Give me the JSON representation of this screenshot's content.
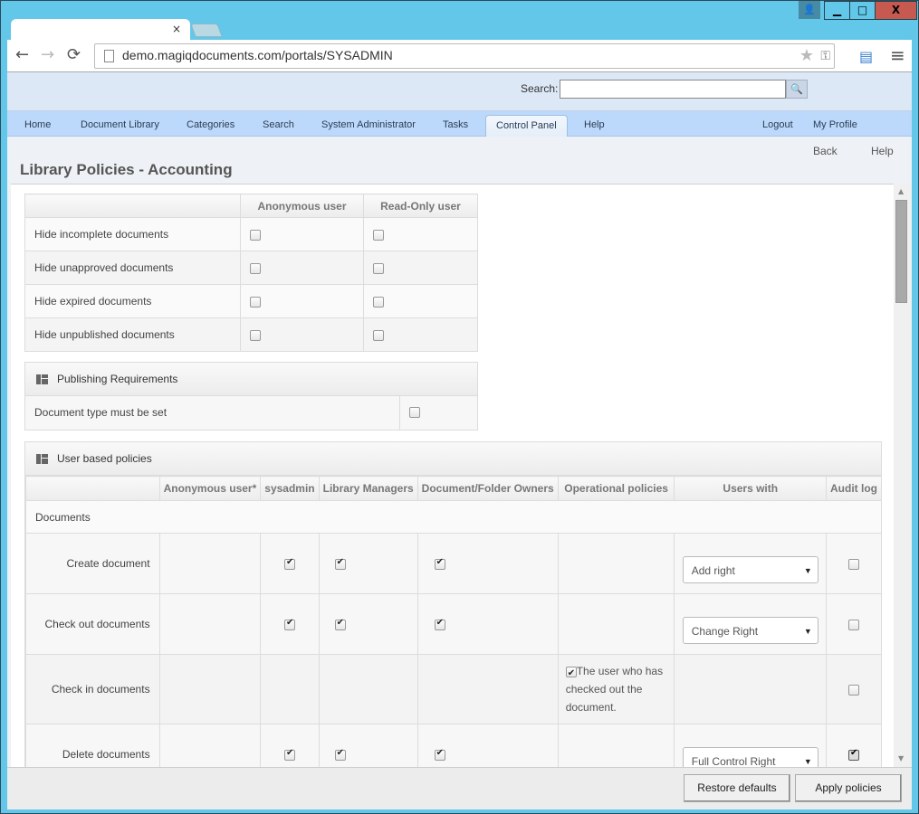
{
  "browser": {
    "url": "demo.magiqdocuments.com/portals/SYSADMIN",
    "tab_close": "×",
    "window_buttons": {
      "minimize": "▁",
      "maximize": "□",
      "close": "X",
      "user": "👤"
    },
    "nav": {
      "back": "←",
      "forward": "→",
      "reload": "⟳"
    },
    "icons": {
      "star": "★",
      "key": "⚿",
      "extension": "▤",
      "menu": "≡"
    }
  },
  "header": {
    "search_label": "Search:",
    "search_value": "",
    "search_button_icon": "🔍"
  },
  "nav": {
    "items": [
      {
        "label": "Home"
      },
      {
        "label": "Document Library"
      },
      {
        "label": "Categories"
      },
      {
        "label": "Search"
      },
      {
        "label": "System Administrator"
      },
      {
        "label": "Tasks"
      },
      {
        "label": "Control Panel",
        "active": true
      },
      {
        "label": "Help"
      }
    ],
    "right": [
      {
        "label": "Logout"
      },
      {
        "label": "My Profile"
      }
    ]
  },
  "subbar": {
    "back": "Back",
    "help": "Help"
  },
  "page_title": "Library Policies - Accounting",
  "visibility_table": {
    "columns": [
      "",
      "Anonymous user",
      "Read-Only user"
    ],
    "rows": [
      {
        "label": "Hide incomplete documents",
        "anonymous": false,
        "readonly": false
      },
      {
        "label": "Hide unapproved documents",
        "anonymous": false,
        "readonly": false
      },
      {
        "label": "Hide expired documents",
        "anonymous": false,
        "readonly": false
      },
      {
        "label": "Hide unpublished documents",
        "anonymous": false,
        "readonly": false
      }
    ]
  },
  "publishing": {
    "title": "Publishing Requirements",
    "rows": [
      {
        "label": "Document type must be set",
        "checked": false
      }
    ]
  },
  "user_policies": {
    "title": "User based policies",
    "columns": [
      "",
      "Anonymous user*",
      "sysadmin",
      "Library Managers",
      "Document/Folder Owners",
      "Operational policies",
      "Users with",
      "Audit log"
    ],
    "section": "Documents",
    "rows": [
      {
        "label": "Create document",
        "sysadmin": true,
        "library_managers": true,
        "owners": true,
        "operational": "",
        "users_with": "Add right",
        "audit": false
      },
      {
        "label": "Check out documents",
        "sysadmin": true,
        "library_managers": true,
        "owners": true,
        "operational": "",
        "users_with": "Change Right",
        "audit": false
      },
      {
        "label": "Check in documents",
        "operational_checked": true,
        "operational": "The user who has checked out the document.",
        "audit": false
      },
      {
        "label": "Delete documents",
        "sysadmin": true,
        "library_managers": true,
        "owners": true,
        "operational": "",
        "users_with": "Full Control Right",
        "audit": true
      }
    ]
  },
  "footer": {
    "restore": "Restore defaults",
    "apply": "Apply policies"
  }
}
